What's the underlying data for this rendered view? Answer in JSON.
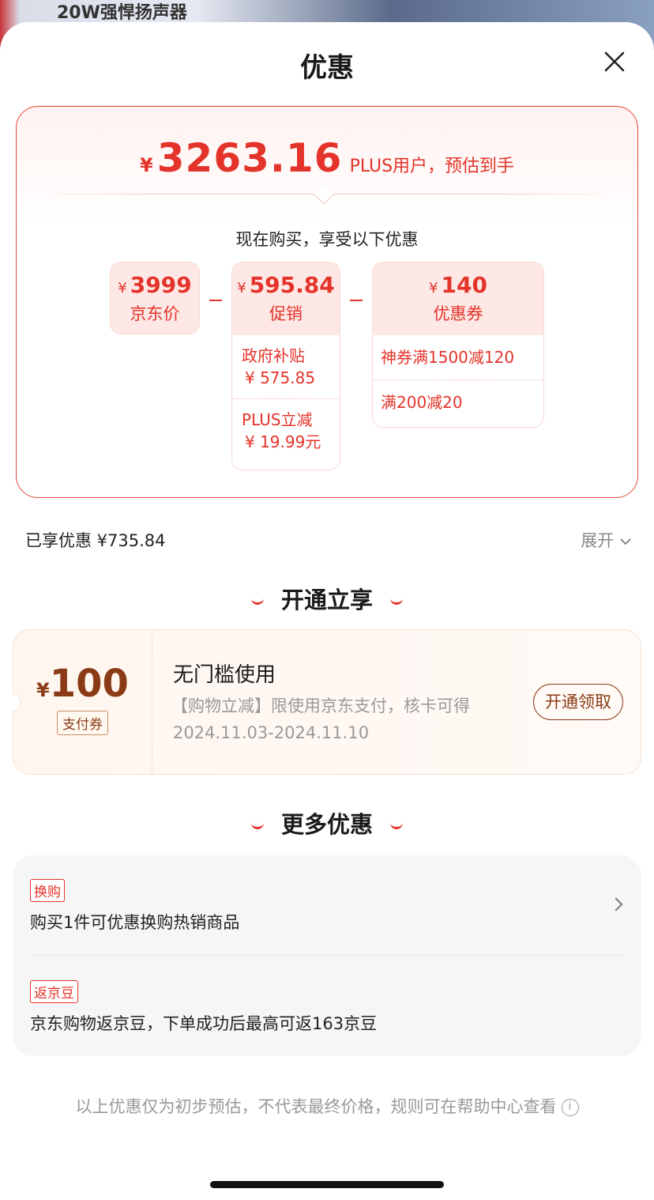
{
  "background": {
    "banner_text": "20W强悍扬声器"
  },
  "header": {
    "title": "优惠",
    "close_icon": "close-icon"
  },
  "summary": {
    "currency": "¥",
    "final_price": "3263.16",
    "final_note": "PLUS用户，预估到手",
    "intro": "现在购买，享受以下优惠"
  },
  "breakdown": {
    "jd_price": {
      "currency": "¥",
      "amount": "3999",
      "label": "京东价"
    },
    "promotion": {
      "currency": "¥",
      "amount": "595.84",
      "label": "促销",
      "items": [
        {
          "title": "政府补贴",
          "value": "¥ 575.85"
        },
        {
          "title": "PLUS立减",
          "value": "¥ 19.99元"
        }
      ]
    },
    "coupon": {
      "currency": "¥",
      "amount": "140",
      "label": "优惠券",
      "items": [
        "神券满1500减120",
        "满200减20"
      ]
    }
  },
  "enjoyed": {
    "label": "已享优惠 ¥735.84",
    "expand_label": "展开"
  },
  "open_section": {
    "title": "开通立享",
    "coupon": {
      "currency": "¥",
      "amount": "100",
      "tag": "支付券",
      "title": "无门槛使用",
      "desc": "【购物立减】限使用京东支付，核卡可得",
      "period": "2024.11.03-2024.11.10",
      "button": "开通领取"
    }
  },
  "more_section": {
    "title": "更多优惠",
    "items": [
      {
        "badge": "换购",
        "desc": "购买1件可优惠换购热销商品"
      },
      {
        "badge": "返京豆",
        "desc": "京东购物返京豆，下单成功后最高可返163京豆"
      }
    ]
  },
  "footer": {
    "note": "以上优惠仅为初步预估，不代表最终价格，规则可在帮助中心查看",
    "info_icon": "i"
  },
  "colors": {
    "accent": "#e4332a",
    "coupon_brown": "#8a3a14"
  }
}
